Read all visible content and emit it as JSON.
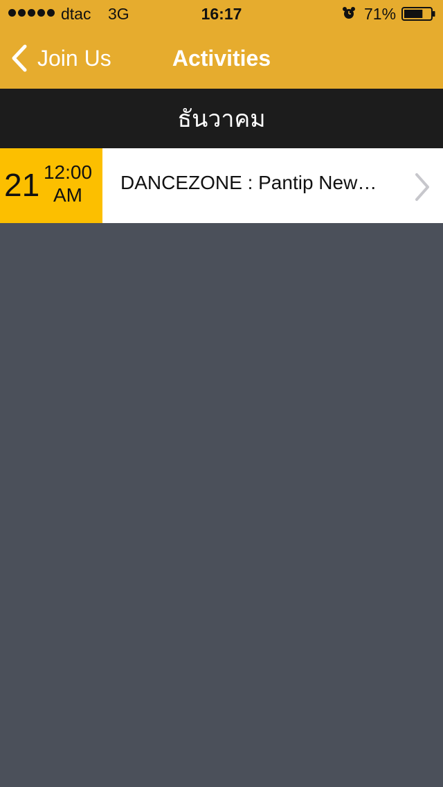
{
  "status_bar": {
    "carrier": "dtac",
    "network": "3G",
    "time": "16:17",
    "battery_percent_label": "71%",
    "battery_level": 0.71,
    "signal_bars": 5,
    "alarm_icon": "alarm-clock-icon"
  },
  "nav": {
    "back_label": "Join Us",
    "title": "Activities"
  },
  "section": {
    "month": "ธันวาคม"
  },
  "events": [
    {
      "day": "21",
      "time": "12:00",
      "meridiem": "AM",
      "title": "DANCEZONE : Pantip New…"
    }
  ],
  "colors": {
    "nav_bg": "#e6ac2e",
    "date_bg": "#fcbf00",
    "section_bg": "#1c1c1c",
    "content_bg": "#4b505a"
  }
}
